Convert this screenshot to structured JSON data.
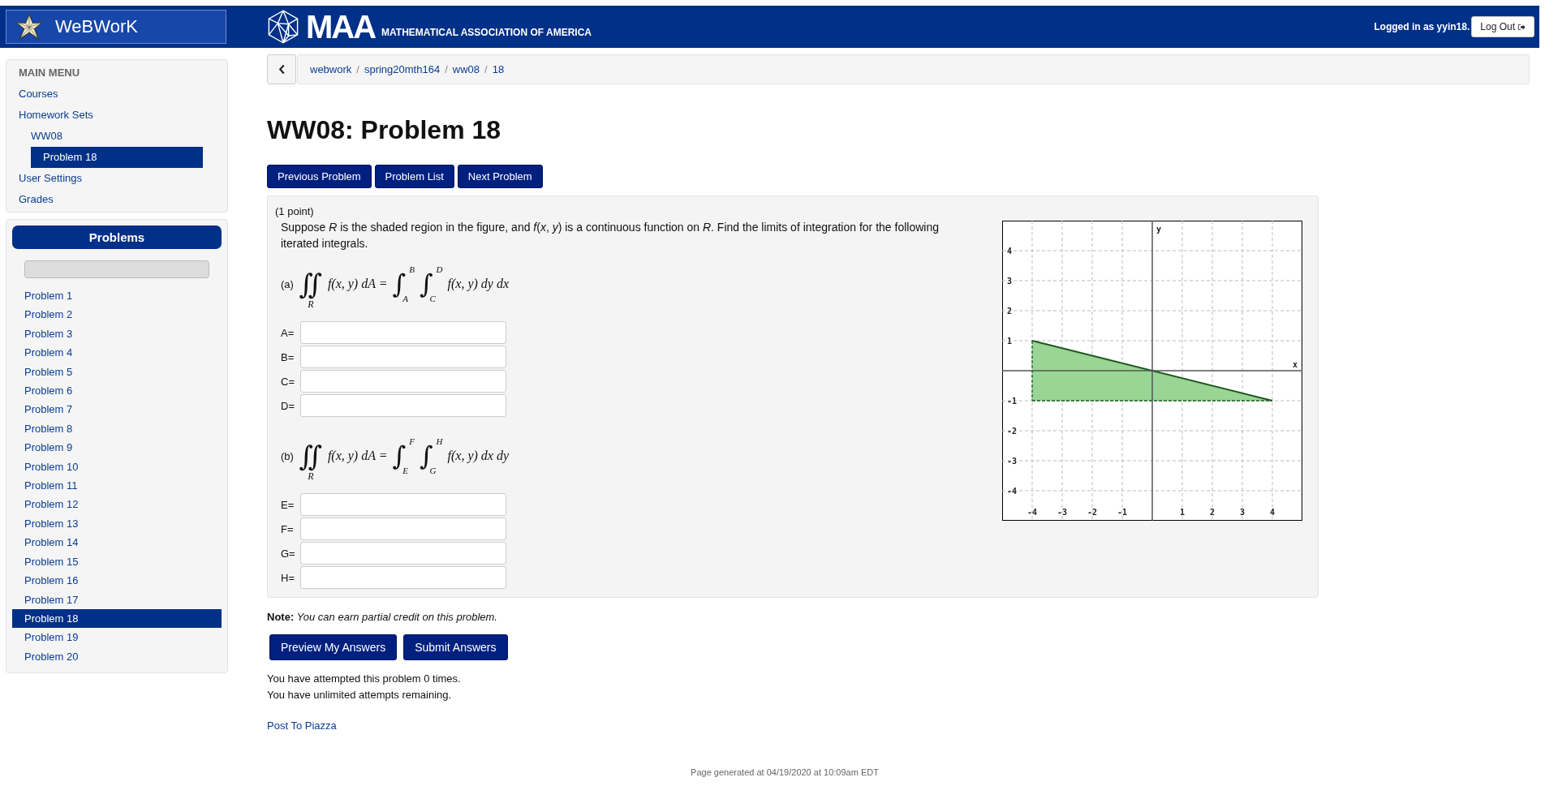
{
  "header": {
    "brand": "WeBWorK",
    "org_short": "MAA",
    "org_full": "MATHEMATICAL ASSOCIATION OF AMERICA",
    "login_text": "Logged in as yyin18.",
    "logout_button": "Log Out"
  },
  "main_menu": {
    "title": "MAIN MENU",
    "items": [
      {
        "label": "Courses",
        "selected": false
      },
      {
        "label": "Homework Sets",
        "selected": false,
        "children": [
          {
            "label": "WW08",
            "selected": false,
            "children": [
              {
                "label": "Problem 18",
                "selected": true
              }
            ]
          }
        ]
      },
      {
        "label": "User Settings",
        "selected": false
      },
      {
        "label": "Grades",
        "selected": false
      }
    ]
  },
  "problems_panel": {
    "title": "Problems",
    "progress": {
      "level": 0
    },
    "items": [
      {
        "label": "Problem 1",
        "selected": false
      },
      {
        "label": "Problem 2",
        "selected": false
      },
      {
        "label": "Problem 3",
        "selected": false
      },
      {
        "label": "Problem 4",
        "selected": false
      },
      {
        "label": "Problem 5",
        "selected": false
      },
      {
        "label": "Problem 6",
        "selected": false
      },
      {
        "label": "Problem 7",
        "selected": false
      },
      {
        "label": "Problem 8",
        "selected": false
      },
      {
        "label": "Problem 9",
        "selected": false
      },
      {
        "label": "Problem 10",
        "selected": false
      },
      {
        "label": "Problem 11",
        "selected": false
      },
      {
        "label": "Problem 12",
        "selected": false
      },
      {
        "label": "Problem 13",
        "selected": false
      },
      {
        "label": "Problem 14",
        "selected": false
      },
      {
        "label": "Problem 15",
        "selected": false
      },
      {
        "label": "Problem 16",
        "selected": false
      },
      {
        "label": "Problem 17",
        "selected": false
      },
      {
        "label": "Problem 18",
        "selected": true
      },
      {
        "label": "Problem 19",
        "selected": false
      },
      {
        "label": "Problem 20",
        "selected": false
      }
    ]
  },
  "breadcrumb": {
    "items": [
      "webwork",
      "spring20mth164",
      "ww08",
      "18"
    ],
    "separators": [
      "/",
      "/",
      "/"
    ]
  },
  "title": "WW08: Problem 18",
  "nav_buttons": [
    "Previous Problem",
    "Problem List",
    "Next Problem"
  ],
  "problem": {
    "points": "(1 point)",
    "statement": "Suppose *R* is the shaded region in the figure, and *f*(*x*, *y*) is a continuous function on *R*. Find the limits of integration for the following iterated integrals.",
    "parts": [
      {
        "label": "(a)",
        "double_sign": "∬",
        "region": "R",
        "lhs": "f(x, y) dA =",
        "outer": {
          "sign": "∫",
          "lower": "A",
          "upper": "B"
        },
        "inner": {
          "sign": "∫",
          "lower": "C",
          "upper": "D"
        },
        "integrand": "f(x, y) dy dx",
        "fields": [
          {
            "label": "A="
          },
          {
            "label": "B="
          },
          {
            "label": "C="
          },
          {
            "label": "D="
          }
        ]
      },
      {
        "label": "(b)",
        "double_sign": "∬",
        "region": "R",
        "lhs": "f(x, y) dA =",
        "outer": {
          "sign": "∫",
          "lower": "E",
          "upper": "F"
        },
        "inner": {
          "sign": "∫",
          "lower": "G",
          "upper": "H"
        },
        "integrand": "f(x, y) dx dy",
        "fields": [
          {
            "label": "E="
          },
          {
            "label": "F="
          },
          {
            "label": "G="
          },
          {
            "label": "H="
          }
        ]
      }
    ],
    "figure": {
      "chart_data": {
        "type": "line",
        "xlabel": "x",
        "ylabel": "y",
        "x": [
          -4,
          4
        ],
        "grid": true,
        "series": [
          {
            "color": "#1c5a22",
            "line_style": "solid",
            "values": [
              1,
              -1
            ]
          },
          {
            "color": "#1c5a22",
            "line_style": "dashed",
            "values": [
              -1,
              -1
            ]
          }
        ],
        "xlim": [
          -5,
          5
        ],
        "ylim": [
          -5,
          5
        ],
        "xticks": [
          -4,
          -3,
          -2,
          -1,
          1,
          2,
          3,
          4
        ],
        "yticks": [
          -4,
          -3,
          -2,
          -1,
          1,
          2,
          3,
          4
        ]
      }
    }
  },
  "note": {
    "label": "Note:",
    "text": "You can earn partial credit on this problem."
  },
  "answer_buttons": [
    "Preview My Answers",
    "Submit Answers"
  ],
  "attempts": [
    "You have attempted this problem 0 times.",
    "You have unlimited attempts remaining."
  ],
  "piazza_link": "Post To Piazza",
  "footer": "Page generated at 04/19/2020 at 10:09am EDT"
}
